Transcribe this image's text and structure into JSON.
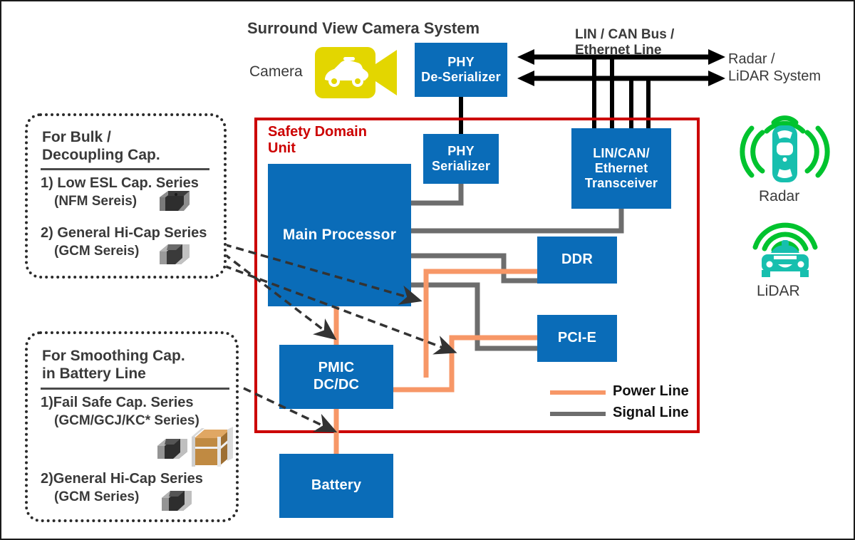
{
  "diagram": {
    "title_camera_system": "Surround View Camera System",
    "label_camera": "Camera",
    "label_bus": "LIN / CAN Bus /\nEthernet Line",
    "label_radar_system": "Radar /\nLiDAR System",
    "label_radar": "Radar",
    "label_lidar": "LiDAR",
    "safety_domain_unit": "Safety Domain\nUnit"
  },
  "blocks": {
    "phy_deserializer": "PHY\nDe-Serializer",
    "phy_serializer": "PHY\nSerializer",
    "lin_can_transceiver": "LIN/CAN/\nEthernet\nTransceiver",
    "main_processor": "Main Processor",
    "ddr": "DDR",
    "pcie": "PCI-E",
    "pmic": "PMIC\nDC/DC",
    "battery": "Battery"
  },
  "legend": {
    "power_line": "Power Line",
    "signal_line": "Signal Line"
  },
  "callout_top": {
    "title": "For Bulk /\nDecoupling Cap.",
    "item1": "1) Low ESL Cap. Series",
    "item1_sub": "(NFM Sereis)",
    "item2": "2) General Hi-Cap Series",
    "item2_sub": "(GCM Sereis)"
  },
  "callout_bottom": {
    "title": "For Smoothing Cap.\nin Battery Line",
    "item1": "1)Fail Safe Cap. Series",
    "item1_sub": "(GCM/GCJ/KC* Series)",
    "item2": "2)General Hi-Cap Series",
    "item2_sub": "(GCM Series)"
  },
  "colors": {
    "block_blue": "#0a6cb8",
    "power_orange": "#f79767",
    "signal_gray": "#6d6d6d",
    "safety_red": "#cc0000",
    "camera_yellow": "#e3d600",
    "wave_green": "#00c32e",
    "car_teal": "#17bfae"
  }
}
